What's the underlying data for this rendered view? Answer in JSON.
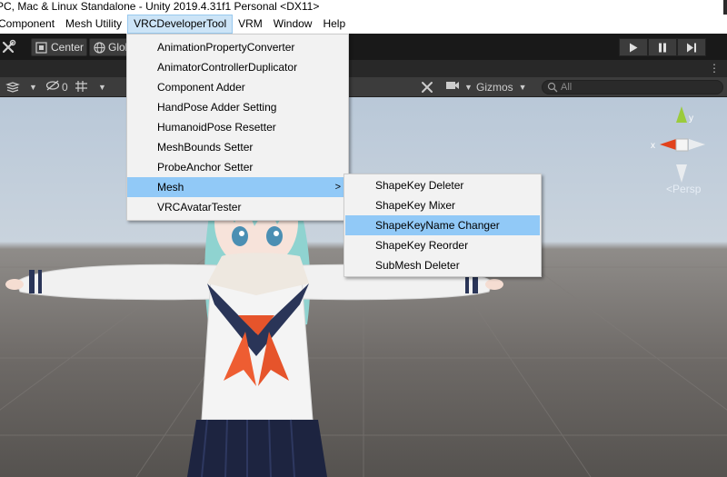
{
  "window": {
    "title": "PC, Mac & Linux Standalone - Unity 2019.4.31f1 Personal <DX11>"
  },
  "menubar": {
    "items": [
      {
        "label": "Component"
      },
      {
        "label": "Mesh Utility"
      },
      {
        "label": "VRCDeveloperTool",
        "active": true
      },
      {
        "label": "VRM"
      },
      {
        "label": "Window"
      },
      {
        "label": "Help"
      }
    ]
  },
  "toolbar": {
    "pivot_label": "Center",
    "space_label": "Global",
    "icons": [
      "tools-icon",
      "pivot-icon",
      "globe-icon",
      "play-icon",
      "pause-icon",
      "step-icon"
    ]
  },
  "scene_toolbar": {
    "gizmos_label": "Gizmos",
    "search_placeholder": "All",
    "hidden_count": "0"
  },
  "viewport": {
    "projection_label": "Persp",
    "axis_x": "x",
    "axis_y": "y",
    "colors": {
      "x": "#e2421c",
      "y": "#9bcb3c",
      "z": "#3b6ed8"
    }
  },
  "dropdown": {
    "items": [
      {
        "label": "AnimationPropertyConverter"
      },
      {
        "label": "AnimatorControllerDuplicator"
      },
      {
        "label": "Component Adder"
      },
      {
        "label": "HandPose Adder Setting"
      },
      {
        "label": "HumanoidPose Resetter"
      },
      {
        "label": "MeshBounds Setter"
      },
      {
        "label": "ProbeAnchor Setter"
      },
      {
        "label": "Mesh",
        "submenu": true,
        "highlighted": true
      },
      {
        "label": "VRCAvatarTester"
      }
    ]
  },
  "submenu": {
    "items": [
      {
        "label": "ShapeKey Deleter"
      },
      {
        "label": "ShapeKey Mixer"
      },
      {
        "label": "ShapeKeyName Changer",
        "highlighted": true
      },
      {
        "label": "ShapeKey Reorder"
      },
      {
        "label": "SubMesh Deleter"
      }
    ]
  }
}
